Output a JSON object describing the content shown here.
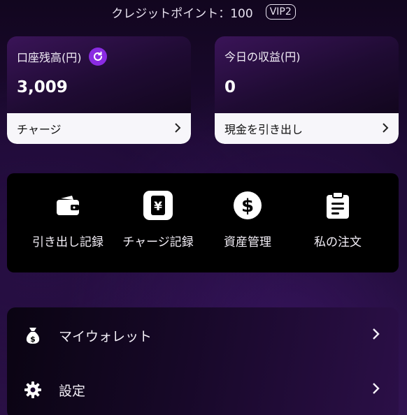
{
  "header": {
    "credit_points": "クレジットポイント：100",
    "vip_badge": "VIP2"
  },
  "balance_card": {
    "title": "口座残高(円)",
    "value": "3,009",
    "action_label": "チャージ"
  },
  "earnings_card": {
    "title": "今日の収益(円)",
    "value": "0",
    "action_label": "現金を引き出し"
  },
  "quick_actions": [
    {
      "label": "引き出し記録",
      "icon": "wallet-icon"
    },
    {
      "label": "チャージ記録",
      "icon": "yen-receipt-icon"
    },
    {
      "label": "資産管理",
      "icon": "dollar-coin-icon"
    },
    {
      "label": "私の注文",
      "icon": "clipboard-icon"
    }
  ],
  "menu": [
    {
      "label": "マイウォレット",
      "icon": "money-bag-icon"
    },
    {
      "label": "設定",
      "icon": "gear-icon"
    }
  ],
  "colors": {
    "accent": "#8a2be2",
    "card_action_bg": "#f7f6fa",
    "panel_bg": "#000000"
  }
}
